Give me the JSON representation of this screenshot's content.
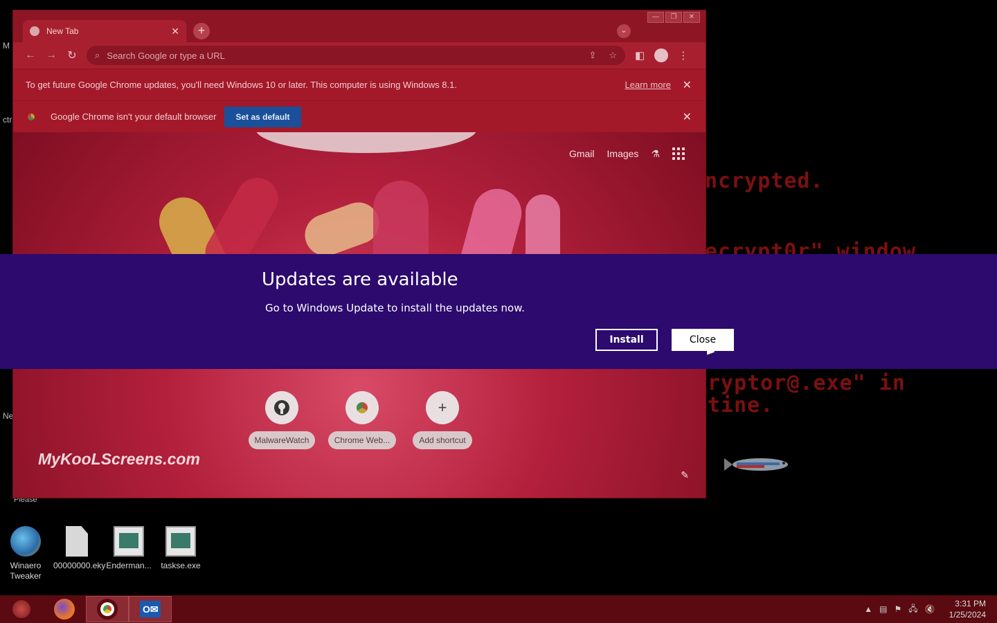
{
  "background": {
    "terminal_lines": [
      "ncrypted.",
      "ecrypt0r\" window",
      "ryptor@.exe\" in",
      "tine."
    ]
  },
  "chrome": {
    "tab_title": "New Tab",
    "omnibox_placeholder": "Search Google or type a URL",
    "infobar_update": {
      "text": "To get future Google Chrome updates, you'll need Windows 10 or later. This computer is using Windows 8.1.",
      "link": "Learn more"
    },
    "infobar_default": {
      "text": "Google Chrome isn't your default browser",
      "button": "Set as default"
    },
    "ntp": {
      "gmail": "Gmail",
      "images": "Images",
      "watermark": "MyKooLScreens.com",
      "shortcuts": [
        {
          "label": "MalwareWatch",
          "icon": "github-icon"
        },
        {
          "label": "Chrome Web...",
          "icon": "chrome-web-store-icon"
        },
        {
          "label": "Add shortcut",
          "icon": "plus-icon"
        }
      ]
    }
  },
  "desktop": {
    "icons": [
      {
        "label": "Winaero Tweaker"
      },
      {
        "label": "00000000.eky"
      },
      {
        "label": "Enderman..."
      },
      {
        "label": "taskse.exe"
      }
    ],
    "fragments": [
      "M",
      "ctr",
      "Ne",
      "Please"
    ]
  },
  "update_banner": {
    "title": "Updates are available",
    "message": "Go to Windows Update to install the updates now.",
    "install": "Install",
    "close": "Close"
  },
  "taskbar": {
    "time": "3:31 PM",
    "date": "1/25/2024"
  },
  "colors": {
    "banner": "#2c0a6e",
    "chrome_frame": "#8e1624",
    "taskbar": "#5a0a10"
  }
}
